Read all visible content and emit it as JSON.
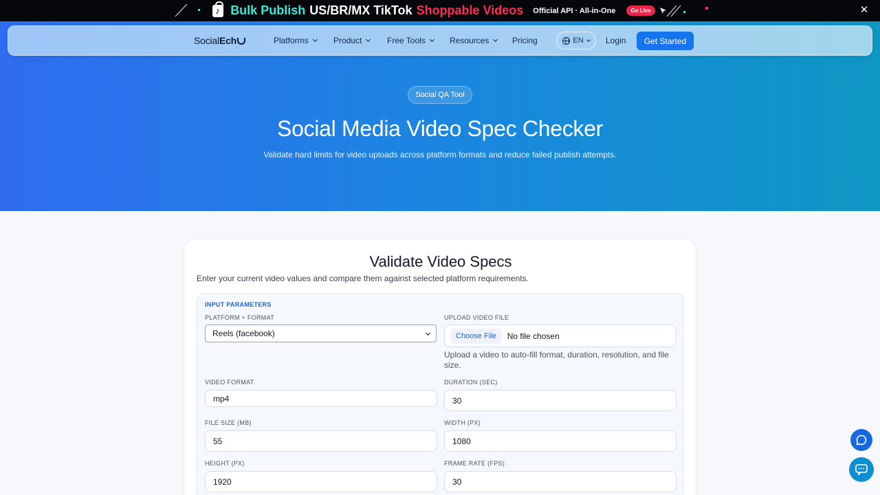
{
  "promo": {
    "bulk": "Bulk Publish",
    "regions": "US/BR/MX TikTok",
    "shoppable": "Shoppable Videos",
    "api": "Official API · All-in-One",
    "go_live": "Go Live",
    "close": "✕",
    "colors": {
      "cyan": "#3ee8d8",
      "red": "#ff2c55",
      "bg": "#05070a"
    }
  },
  "nav": {
    "logo_part1": "Social",
    "logo_part2": "Ech",
    "items": [
      {
        "label": "Platforms"
      },
      {
        "label": "Product"
      },
      {
        "label": "Free Tools"
      },
      {
        "label": "Resources"
      },
      {
        "label": "Pricing"
      }
    ],
    "lang": "EN",
    "login": "Login",
    "cta": "Get Started"
  },
  "hero": {
    "pill": "Social QA Tool",
    "title": "Social Media Video Spec Checker",
    "subtitle": "Validate hard limits for video uploads across platform formats and reduce failed publish attempts."
  },
  "card": {
    "title": "Validate Video Specs",
    "description": "Enter your current video values and compare them against selected platform requirements.",
    "panel_title": "INPUT PARAMETERS",
    "platform_label": "PLATFORM + FORMAT",
    "platform_value": "Reels (facebook)",
    "upload_label": "UPLOAD VIDEO FILE",
    "upload_button": "Choose File",
    "upload_status": "No file chosen",
    "upload_help": "Upload a video to auto-fill format, duration, resolution, and file size.",
    "format_label": "VIDEO FORMAT",
    "format_value": "mp4",
    "duration_label": "DURATION (SEC)",
    "duration_value": "30",
    "filesize_label": "FILE SIZE (MB)",
    "filesize_value": "55",
    "width_label": "WIDTH (PX)",
    "width_value": "1080",
    "height_label": "HEIGHT (PX)",
    "height_value": "1920",
    "fps_label": "FRAME RATE (FPS)",
    "fps_value": "30"
  },
  "icons": {
    "fab_top": "chat-bubble-icon",
    "fab_bottom": "message-icon",
    "close": "close-icon",
    "globe": "globe-icon"
  }
}
